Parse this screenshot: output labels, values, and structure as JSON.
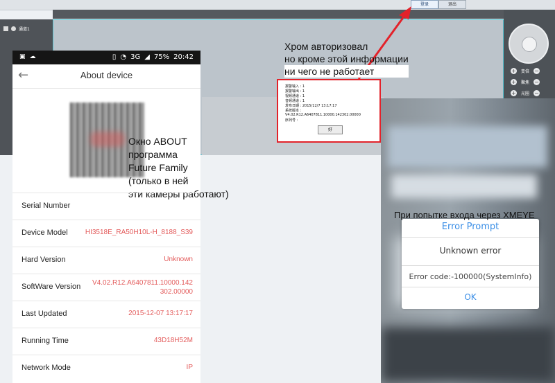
{
  "web_ui": {
    "top_button_1": "登录",
    "top_button_2": "退出",
    "channel_label": "通道1",
    "ptz": [
      "变倍",
      "聚焦",
      "光圈"
    ],
    "info_rows": [
      "报警输入 : 1",
      "报警输出 : 1",
      "视频通道 : 1",
      "音频通道 : 1",
      "发布日期 : 2015/12/7 13:17:17",
      "系统版本 :",
      "V4.02.R12.A6407811.10000.142302.00000",
      "序列号 :"
    ],
    "ok_button": "好"
  },
  "annotations": {
    "chrome_note": [
      "Хром авторизовал",
      "но кроме этой информации",
      "ни чего не работает"
    ],
    "about_note": [
      "Окно ABOUT",
      "программа",
      "Future Family",
      "(только в ней",
      "эти камеры работают)"
    ],
    "xmeye_note": "При попытке входа через XMEYE"
  },
  "phone": {
    "status_right": "3G",
    "battery": "75%",
    "time": "20:42",
    "title": "About device",
    "rows": [
      {
        "label": "Serial Number",
        "value": ""
      },
      {
        "label": "Device Model",
        "value": "HI3518E_RA50H10L-H_8188_S39"
      },
      {
        "label": "Hard Version",
        "value": "Unknown"
      },
      {
        "label": "SoftWare Version",
        "value_line1": "V4.02.R12.A6407811.10000.142",
        "value_line2": "302.00000"
      },
      {
        "label": "Last Updated",
        "value": "2015-12-07 13:17:17"
      },
      {
        "label": "Running Time",
        "value": "43D18H52M"
      },
      {
        "label": "Network Mode",
        "value": "IP"
      }
    ]
  },
  "xmeye_dialog": {
    "title": "Error Prompt",
    "message": "Unknown error",
    "code": "Error code:-100000(SystemInfo)",
    "ok": "OK"
  },
  "colors": {
    "highlight_red": "#e3222a",
    "value_red": "#e35b5b",
    "dialog_blue": "#3a8ee6"
  }
}
